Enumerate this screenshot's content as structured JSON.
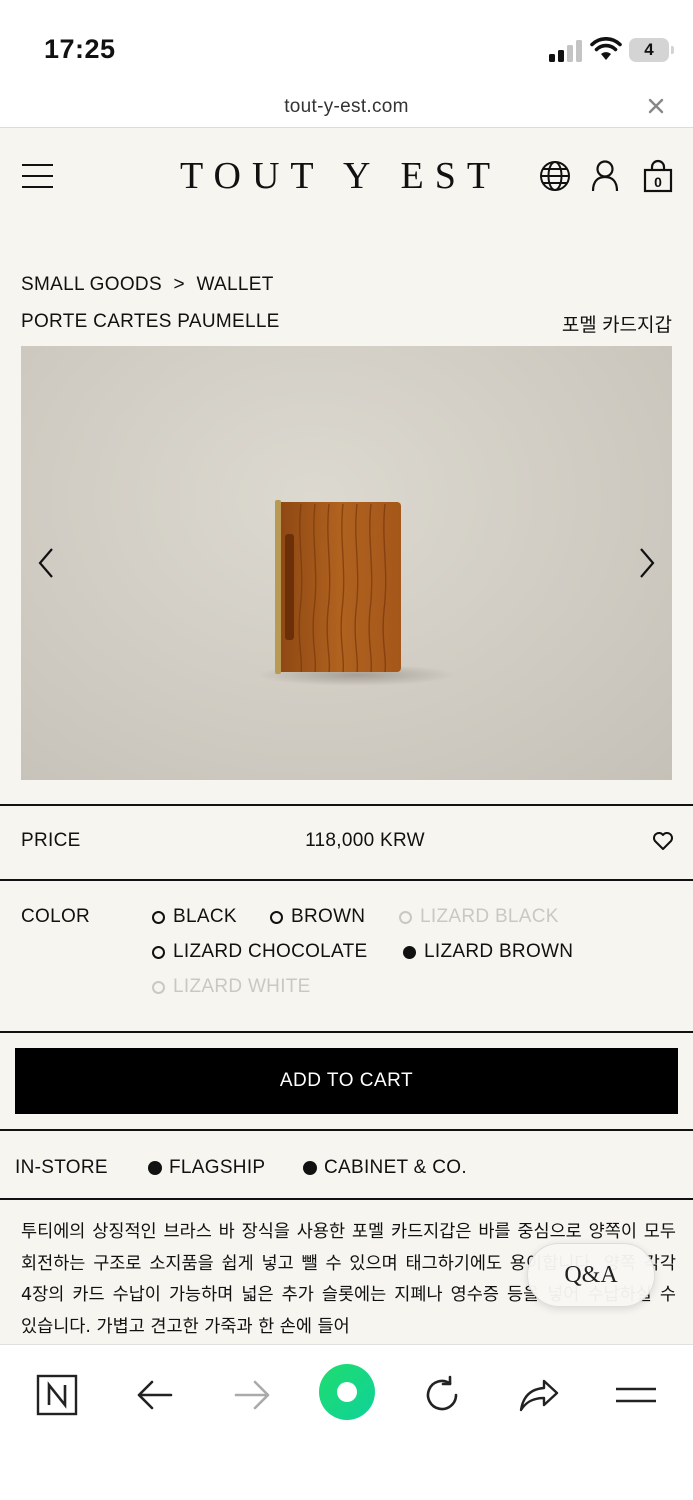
{
  "status_bar": {
    "time": "17:25",
    "battery": "4"
  },
  "browser": {
    "url": "tout-y-est.com"
  },
  "header": {
    "logo": "TOUT Y EST",
    "cart_count": "0"
  },
  "breadcrumb": {
    "category": "SMALL GOODS",
    "separator": ">",
    "subcategory": "WALLET"
  },
  "product": {
    "name_en": "PORTE CARTES PAUMELLE",
    "name_ko": "포멜 카드지갑",
    "price_label": "PRICE",
    "price": "118,000 KRW",
    "color_label": "COLOR",
    "colors": [
      {
        "label": "BLACK",
        "state": "available"
      },
      {
        "label": "BROWN",
        "state": "available"
      },
      {
        "label": "LIZARD BLACK",
        "state": "disabled"
      },
      {
        "label": "LIZARD CHOCOLATE",
        "state": "available"
      },
      {
        "label": "LIZARD BROWN",
        "state": "selected"
      },
      {
        "label": "LIZARD WHITE",
        "state": "disabled"
      }
    ],
    "add_to_cart": "ADD TO CART",
    "instore_label": "IN-STORE",
    "stores": [
      "FLAGSHIP",
      "CABINET & CO."
    ],
    "description": "투티에의 상징적인 브라스 바 장식을 사용한 포멜 카드지갑은 바를 중심으로 양쪽이 모두 회전하는 구조로 소지품을 쉽게 넣고 뺄 수 있으며 태그하기에도 용이합니다. 양쪽 각각 4장의 카드 수납이 가능하며 넓은 추가 슬롯에는 지폐나 영수증 등을 넣어 수납하실 수 있습니다. 가볍고 견고한 가죽과 한 손에 들어",
    "qa_button": "Q&A"
  },
  "colors": {
    "background": "#f6f5f0",
    "text": "#111111",
    "button_bg": "#000000",
    "disabled": "#c9c9c4",
    "leather": "#a85a1f",
    "toolbar_green": "#1fdc6e"
  },
  "icons": [
    "signal-icon",
    "wifi-icon",
    "battery-icon",
    "close-icon",
    "hamburger-icon",
    "globe-icon",
    "user-icon",
    "cart-icon",
    "chevron-left-icon",
    "chevron-right-icon",
    "heart-icon",
    "naver-n-icon",
    "back-arrow-icon",
    "forward-arrow-icon",
    "green-dot-icon",
    "reload-icon",
    "share-icon",
    "menu-icon"
  ]
}
